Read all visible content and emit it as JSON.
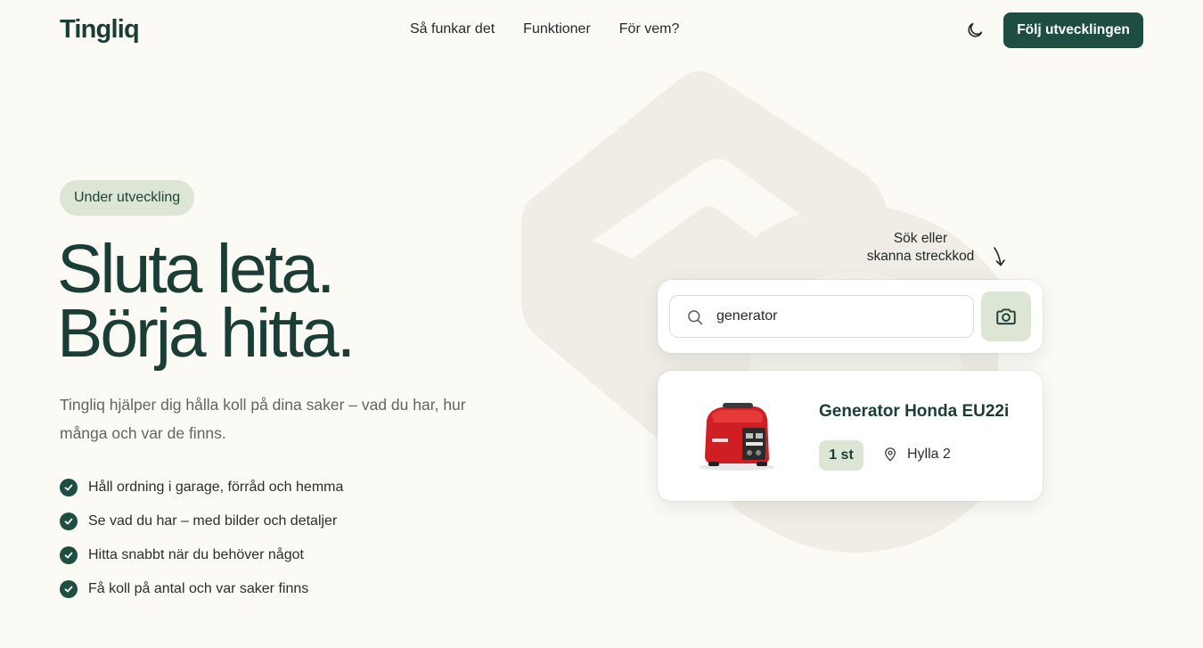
{
  "header": {
    "logo": "Tingliq",
    "nav": [
      "Så funkar det",
      "Funktioner",
      "För vem?"
    ],
    "theme_icon": "moon-icon",
    "cta_label": "Följ utvecklingen"
  },
  "hero": {
    "badge": "Under utveckling",
    "headline": [
      "Sluta leta.",
      "Börja hitta."
    ],
    "description": "Tingliq hjälper dig hålla koll på dina saker – vad du har, hur många och var de finns.",
    "features": [
      "Håll ordning i garage, förråd och hemma",
      "Se vad du har – med bilder och detaljer",
      "Hitta snabbt när du behöver något",
      "Få koll på antal och var saker finns"
    ]
  },
  "demo": {
    "hint": [
      "Sök eller",
      "skanna streckkod"
    ],
    "search_value": "generator",
    "result": {
      "title": "Generator Honda EU22i",
      "quantity": "1 st",
      "location": "Hylla 2"
    }
  },
  "colors": {
    "background": "#fbfaf5",
    "brand": "#1e4d41",
    "soft_green": "#dde5d4"
  }
}
